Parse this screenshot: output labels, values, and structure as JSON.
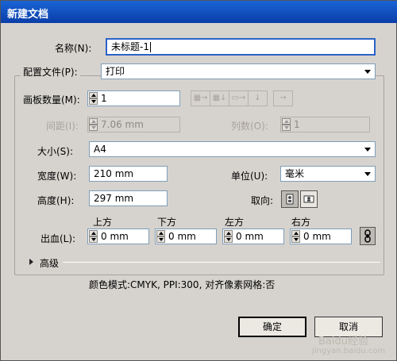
{
  "window": {
    "title": "新建文档"
  },
  "name": {
    "label": "名称(N):",
    "value": "未标题-1"
  },
  "profile": {
    "label": "配置文件(P):",
    "value": "打印"
  },
  "artboards": {
    "label": "画板数量(M):",
    "value": "1",
    "layout_buttons": [
      "grid-by-row-icon",
      "grid-by-column-icon",
      "arrange-by-row-icon",
      "arrange-by-column-icon",
      "right-to-left-icon"
    ]
  },
  "spacing": {
    "label": "间距(I):",
    "value": "7.06 mm"
  },
  "columns": {
    "label": "列数(O):",
    "value": "1"
  },
  "size": {
    "label": "大小(S):",
    "value": "A4"
  },
  "width": {
    "label": "宽度(W):",
    "value": "210 mm"
  },
  "units": {
    "label": "单位(U):",
    "value": "毫米"
  },
  "height": {
    "label": "高度(H):",
    "value": "297 mm"
  },
  "orientation": {
    "label": "取向:",
    "options": [
      "portrait-icon",
      "landscape-icon"
    ],
    "selected": "portrait-icon"
  },
  "bleed": {
    "label": "出血(L):",
    "top": {
      "label": "上方",
      "value": "0 mm"
    },
    "bottom": {
      "label": "下方",
      "value": "0 mm"
    },
    "left": {
      "label": "左方",
      "value": "0 mm"
    },
    "right": {
      "label": "右方",
      "value": "0 mm"
    },
    "link_icon": "chain-link-icon"
  },
  "advanced": {
    "label": "高级"
  },
  "summary": {
    "text": "颜色模式:CMYK, PPI:300, 对齐像素网格:否"
  },
  "buttons": {
    "ok": "确定",
    "cancel": "取消"
  },
  "watermark": {
    "line1": "Baidu经验",
    "line2": "jingyan.baidu.com"
  },
  "colors": {
    "titlebar": "#0a3ea8",
    "dialog_bg": "#d6d3ce",
    "field_border": "#7f9db9"
  }
}
